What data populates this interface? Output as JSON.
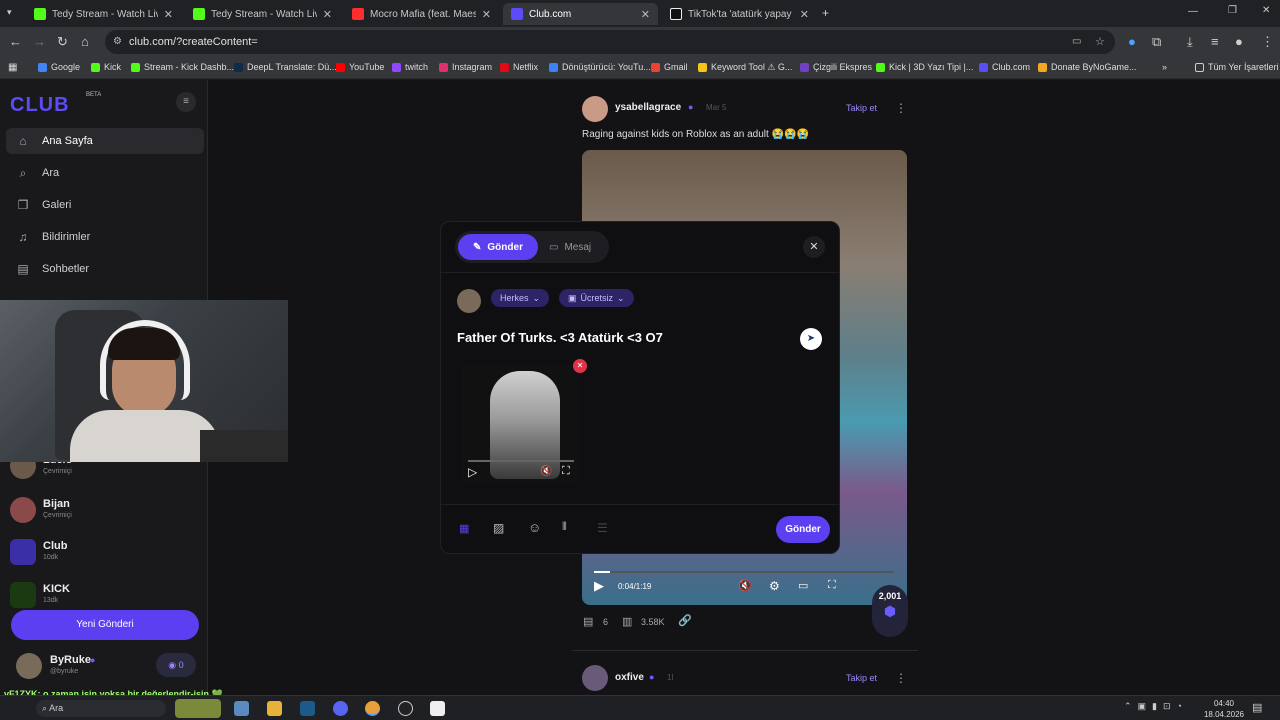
{
  "tabs": [
    {
      "title": "Tedy Stream - Watch Live on Kick",
      "color": "#53fc18"
    },
    {
      "title": "Tedy Stream - Watch Live on Kick",
      "color": "#53fc18"
    },
    {
      "title": "Mocro Mafia (feat. Maes) - YouTube",
      "color": "#ff2e2e"
    },
    {
      "title": "Club.com",
      "color": "#5b4cf5"
    },
    {
      "title": "TikTok'ta 'atatürk yapay zeka c...",
      "color": "#eeeeee"
    }
  ],
  "address": {
    "url": "club.com/?createContent="
  },
  "bookmarks": [
    {
      "label": "Google",
      "color": "#4285f4"
    },
    {
      "label": "Kick",
      "color": "#53fc18"
    },
    {
      "label": "Stream - Kick Dashb...",
      "color": "#53fc18"
    },
    {
      "label": "DeepL Translate: Dü...",
      "color": "#0f2b46"
    },
    {
      "label": "YouTube",
      "color": "#ff0000"
    },
    {
      "label": "twitch",
      "color": "#9146ff"
    },
    {
      "label": "Instagram",
      "color": "#e1306c"
    },
    {
      "label": "Netflix",
      "color": "#e50914"
    },
    {
      "label": "Dönüştürücü: YouTu...",
      "color": "#3b82f6"
    },
    {
      "label": "Gmail",
      "color": "#ea4335"
    },
    {
      "label": "Keyword Tool ⚠ G...",
      "color": "#f5c518"
    },
    {
      "label": "Çizgili Ekspres",
      "color": "#6f42c1"
    },
    {
      "label": "Kick | 3D Yazı Tipi |...",
      "color": "#53fc18"
    },
    {
      "label": "Club.com",
      "color": "#5b4cf5"
    },
    {
      "label": "Donate ByNoGame...",
      "color": "#f5a623"
    }
  ],
  "bookmarks_all": "Tüm Yer İşaretleri",
  "sidebar": {
    "logo": "CLUB",
    "beta": "BETA",
    "nav": [
      {
        "label": "Ana Sayfa",
        "icon": "⌂"
      },
      {
        "label": "Ara",
        "icon": "⌕"
      },
      {
        "label": "Galeri",
        "icon": "❐"
      },
      {
        "label": "Bildirimler",
        "icon": "♫"
      },
      {
        "label": "Sohbetler",
        "icon": "▤"
      }
    ],
    "friends": [
      {
        "name": "Luclo",
        "status": "Çevrimiçi"
      },
      {
        "name": "Bijan",
        "status": "Çevrimiçi"
      },
      {
        "name": "Club",
        "status": "10dk"
      },
      {
        "name": "KICK",
        "status": "13dk"
      }
    ],
    "new_post": "Yeni Gönderi",
    "user": {
      "name": "ByRuke",
      "handle": "@byruke",
      "points": "0"
    }
  },
  "feed": {
    "post1": {
      "user": "ysabellagrace",
      "time": "Mar 5",
      "follow": "Takip et",
      "text": "Raging against kids on Roblox as an adult 😭😭😭",
      "video_time": "0:04/1:19",
      "comments": "6",
      "views": "3.58K",
      "badge": "2,001"
    },
    "post2": {
      "user": "oxfive",
      "time": "1l",
      "follow": "Takip et"
    }
  },
  "modal": {
    "tab_send": "Gönder",
    "tab_message": "Mesaj",
    "audience": "Herkes",
    "price": "Ücretsiz",
    "text": "Father Of Turks. <3 Atatürk <3 O7",
    "send": "Gönder"
  },
  "overlay": {
    "ticker": "vF1ZYK: o zaman işin yoksa bir değerlendir-işin 💚"
  },
  "taskbar": {
    "search": "Ara",
    "time": "04:40",
    "date": "18.04.2026"
  }
}
